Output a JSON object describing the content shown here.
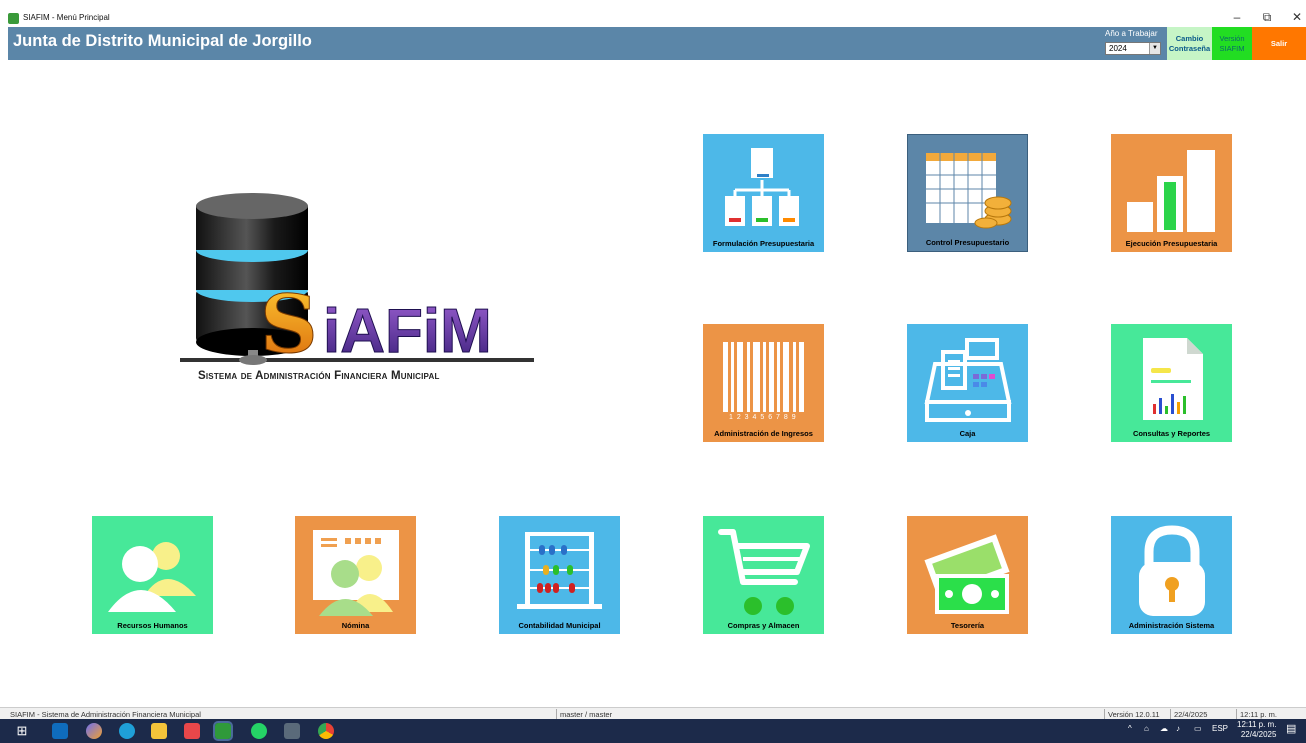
{
  "window": {
    "title": "SIAFIM - Menú Principal"
  },
  "header": {
    "org_name": "Junta de Distrito Municipal de Jorgillo",
    "year_label": "Año a Trabajar",
    "year_value": "2024",
    "change_password_line1": "Cambio",
    "change_password_line2": "Contraseña",
    "version_line1": "Versión",
    "version_line2": "SIAFIM",
    "exit_label": "Salir",
    "colors": {
      "header_bg": "#5b86a8",
      "password_btn": "#c6f5c6",
      "version_btn": "#22dd22",
      "exit_btn": "#ff7700"
    }
  },
  "logo": {
    "brand": "SIAFIM",
    "subtitle": "Sistema de Administración Financiera Municipal"
  },
  "modules": [
    {
      "label": "Formulación Presupuestaria",
      "icon": "org-chart-icon",
      "color": "blue"
    },
    {
      "label": "Control Presupuestario",
      "icon": "spreadsheet-coins-icon",
      "color": "steel"
    },
    {
      "label": "Ejecución Presupuestaria",
      "icon": "bar-chart-icon",
      "color": "orange"
    },
    {
      "label": "Administración de Ingresos",
      "icon": "barcode-icon",
      "color": "orange"
    },
    {
      "label": "Caja",
      "icon": "cash-register-icon",
      "color": "blue"
    },
    {
      "label": "Consultas y Reportes",
      "icon": "report-document-icon",
      "color": "green"
    },
    {
      "label": "Recursos Humanos",
      "icon": "people-icon",
      "color": "green"
    },
    {
      "label": "Nómina",
      "icon": "payroll-icon",
      "color": "orange"
    },
    {
      "label": "Contabilidad Municipal",
      "icon": "abacus-icon",
      "color": "blue"
    },
    {
      "label": "Compras y Almacen",
      "icon": "shopping-cart-icon",
      "color": "green"
    },
    {
      "label": "Tesorería",
      "icon": "money-icon",
      "color": "orange"
    },
    {
      "label": "Administración Sistema",
      "icon": "padlock-icon",
      "color": "blue"
    }
  ],
  "barcode_digits": "1 2 3 4 5 6 7 8 9",
  "status": {
    "app": "SIAFIM - Sistema de Administración Financiera Municipal",
    "user": "master / master",
    "version": "Versión 12.0.11",
    "date": "22/4/2025",
    "time": "12:11 p. m."
  },
  "taskbar": {
    "lang": "ESP",
    "time": "12:11 p. m.",
    "date": "22/4/2025"
  }
}
